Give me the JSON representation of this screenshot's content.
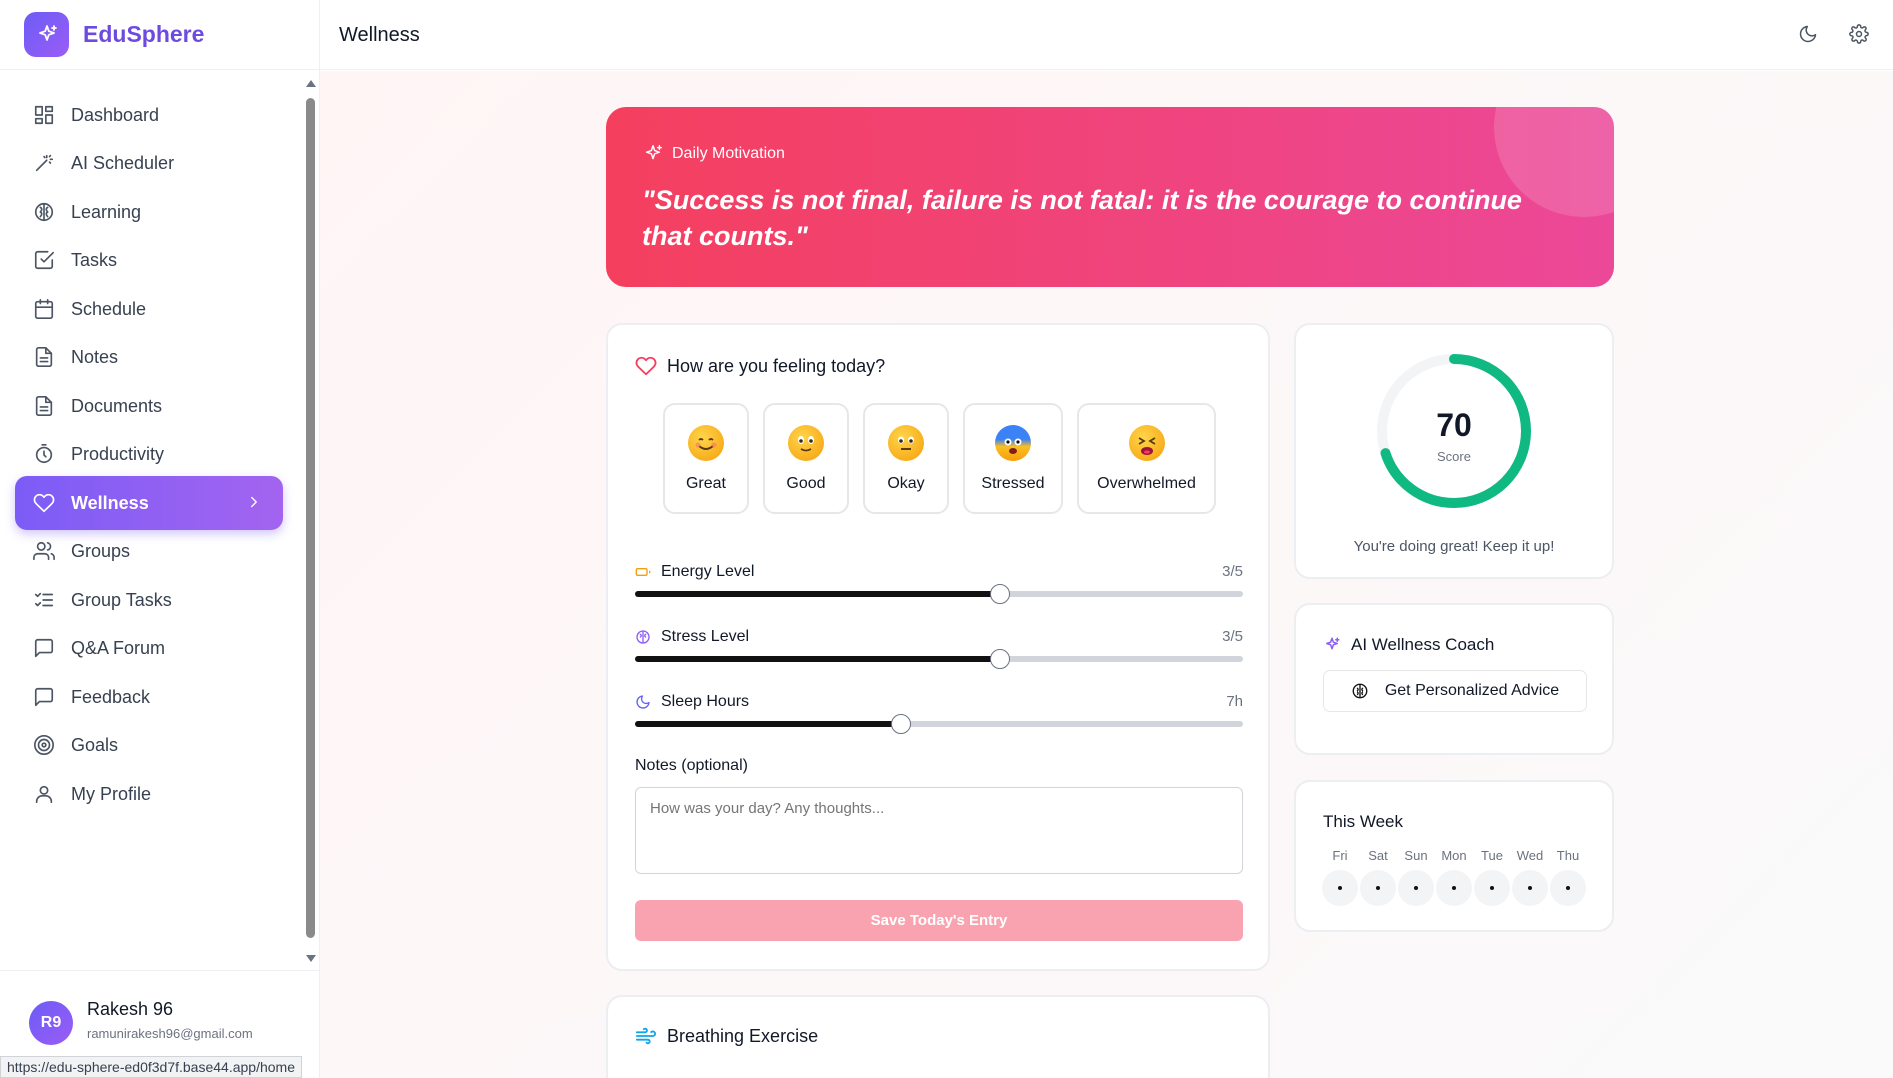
{
  "brand": {
    "name": "EduSphere"
  },
  "sidebar": {
    "items": [
      {
        "label": "Dashboard",
        "icon": "dashboard-icon"
      },
      {
        "label": "AI Scheduler",
        "icon": "wand-icon"
      },
      {
        "label": "Learning",
        "icon": "brain-icon"
      },
      {
        "label": "Tasks",
        "icon": "check-square-icon"
      },
      {
        "label": "Schedule",
        "icon": "calendar-icon"
      },
      {
        "label": "Notes",
        "icon": "file-icon"
      },
      {
        "label": "Documents",
        "icon": "file-icon"
      },
      {
        "label": "Productivity",
        "icon": "timer-icon"
      },
      {
        "label": "Wellness",
        "icon": "heart-icon",
        "active": true
      },
      {
        "label": "Groups",
        "icon": "users-icon"
      },
      {
        "label": "Group Tasks",
        "icon": "list-checks-icon"
      },
      {
        "label": "Q&A Forum",
        "icon": "message-icon"
      },
      {
        "label": "Feedback",
        "icon": "message-icon"
      },
      {
        "label": "Goals",
        "icon": "target-icon"
      },
      {
        "label": "My Profile",
        "icon": "user-icon"
      }
    ]
  },
  "user": {
    "initials": "R9",
    "name": "Rakesh 96",
    "email": "ramunirakesh96@gmail.com"
  },
  "status_bar": {
    "url": "https://edu-sphere-ed0f3d7f.base44.app/home"
  },
  "header": {
    "title": "Wellness"
  },
  "motivation": {
    "label": "Daily Motivation",
    "quote": "\"Success is not final, failure is not fatal: it is the courage to continue that counts.\""
  },
  "mood": {
    "title": "How are you feeling today?",
    "options": [
      {
        "label": "Great",
        "emoji": "smiling-face-icon"
      },
      {
        "label": "Good",
        "emoji": "slightly-smiling-face-icon"
      },
      {
        "label": "Okay",
        "emoji": "neutral-face-icon"
      },
      {
        "label": "Stressed",
        "emoji": "anxious-face-icon"
      },
      {
        "label": "Overwhelmed",
        "emoji": "tired-face-icon"
      }
    ]
  },
  "sliders": {
    "energy": {
      "label": "Energy Level",
      "value_text": "3/5",
      "value": 3,
      "max": 5
    },
    "stress": {
      "label": "Stress Level",
      "value_text": "3/5",
      "value": 3,
      "max": 5
    },
    "sleep": {
      "label": "Sleep Hours",
      "value_text": "7h",
      "value": 7,
      "max": 16
    }
  },
  "notes": {
    "label": "Notes (optional)",
    "placeholder": "How was your day? Any thoughts..."
  },
  "save_button": {
    "label": "Save Today's Entry"
  },
  "score": {
    "value": "70",
    "label": "Score",
    "message": "You're doing great! Keep it up!",
    "percent": 70
  },
  "coach": {
    "title": "AI Wellness Coach",
    "button_label": "Get Personalized Advice"
  },
  "week": {
    "title": "This Week",
    "days": [
      "Fri",
      "Sat",
      "Sun",
      "Mon",
      "Tue",
      "Wed",
      "Thu"
    ]
  },
  "breathing": {
    "title": "Breathing Exercise"
  },
  "colors": {
    "brand": "#6d4be0",
    "accent_pink": "#f43f5e",
    "score_green": "#10b981"
  }
}
